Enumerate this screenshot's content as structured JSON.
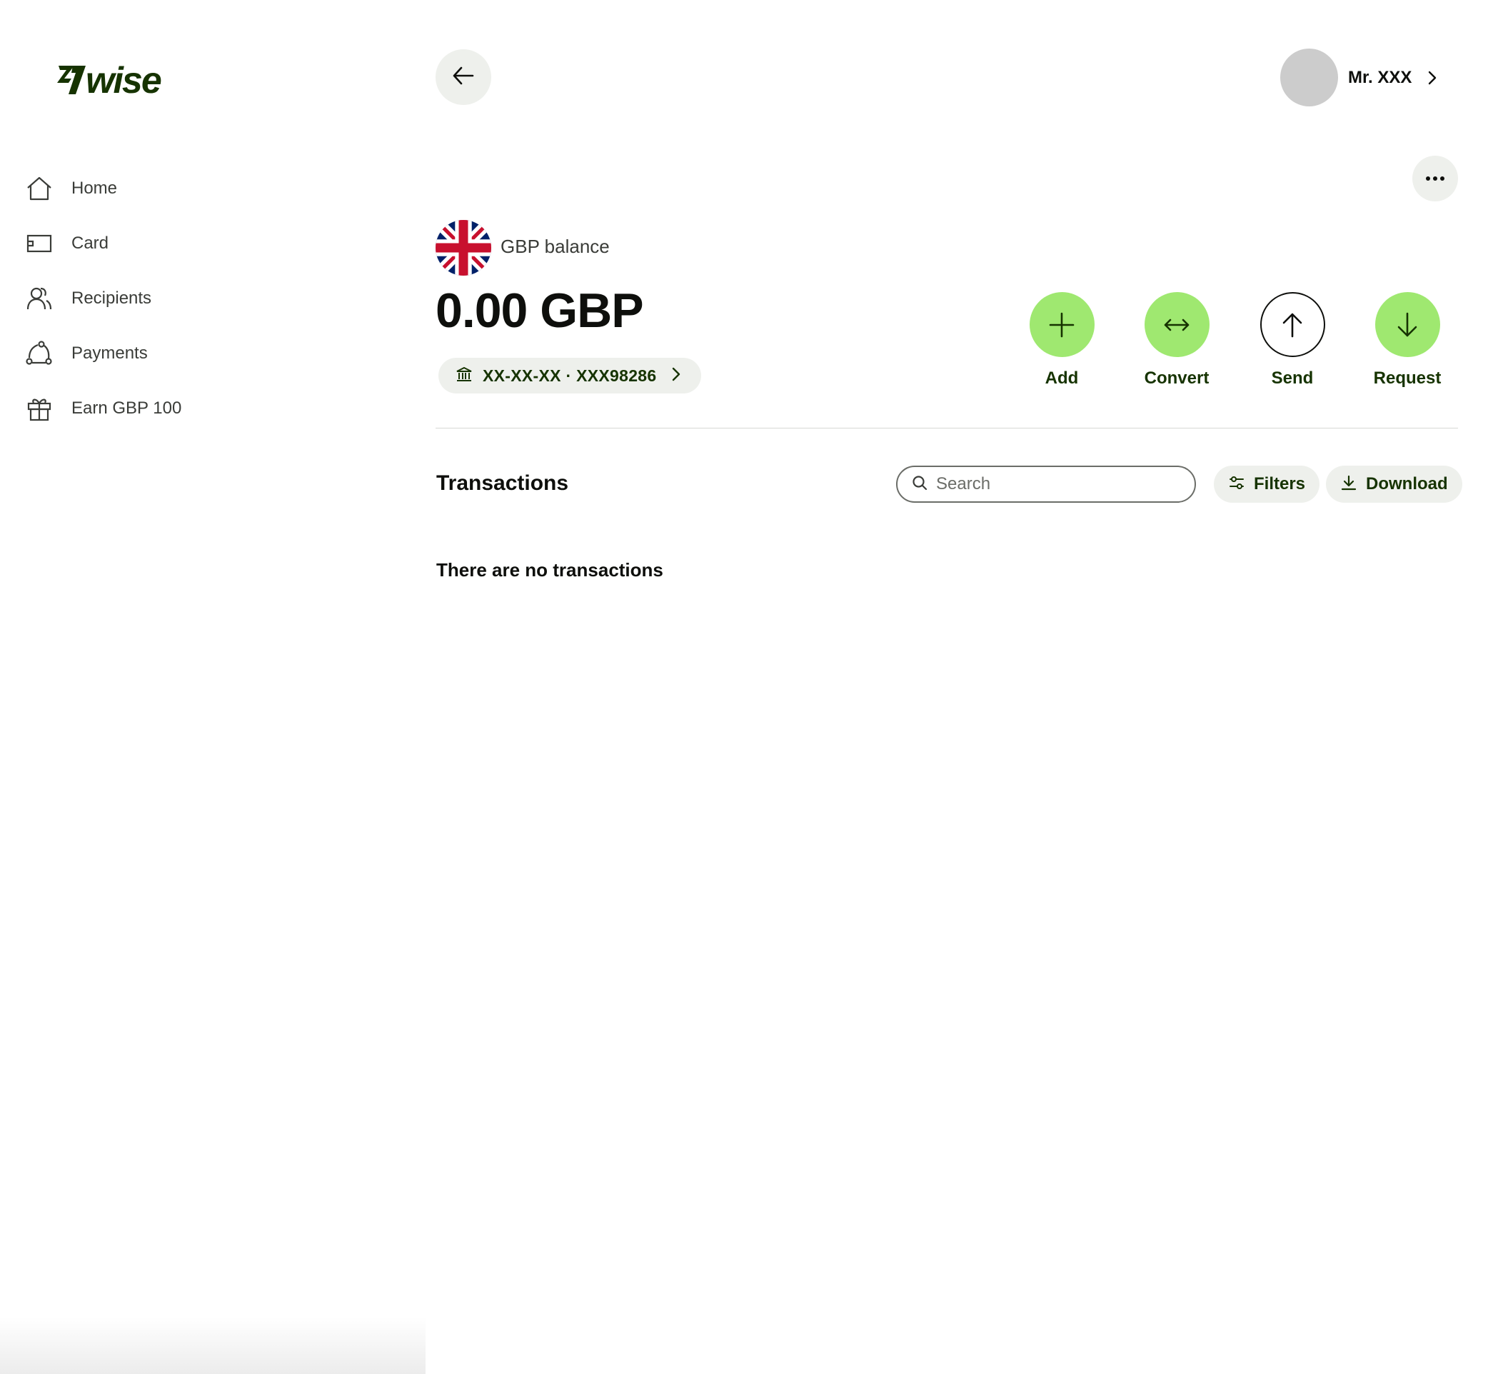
{
  "brand": {
    "logo_text": "7WISE",
    "accent": "#9fe870",
    "dark_green": "#163300"
  },
  "sidebar": {
    "items": [
      {
        "label": "Home",
        "icon": "home-icon"
      },
      {
        "label": "Card",
        "icon": "card-icon"
      },
      {
        "label": "Recipients",
        "icon": "recipients-icon"
      },
      {
        "label": "Payments",
        "icon": "payments-icon"
      },
      {
        "label": "Earn GBP 100",
        "icon": "gift-icon"
      }
    ]
  },
  "header": {
    "back_icon": "arrow-left-icon",
    "profile_name": "Mr. XXX",
    "more_icon": "more-horizontal-icon"
  },
  "balance": {
    "flag": "uk-flag-icon",
    "label": "GBP balance",
    "amount": "0.00 GBP",
    "account_details": "XX-XX-XX · XXX98286"
  },
  "actions": [
    {
      "label": "Add",
      "icon": "plus-icon"
    },
    {
      "label": "Convert",
      "icon": "convert-icon"
    },
    {
      "label": "Send",
      "icon": "arrow-up-icon"
    },
    {
      "label": "Request",
      "icon": "arrow-down-icon"
    }
  ],
  "transactions": {
    "title": "Transactions",
    "search_placeholder": "Search",
    "filters_label": "Filters",
    "download_label": "Download",
    "empty_message": "There are no transactions"
  }
}
